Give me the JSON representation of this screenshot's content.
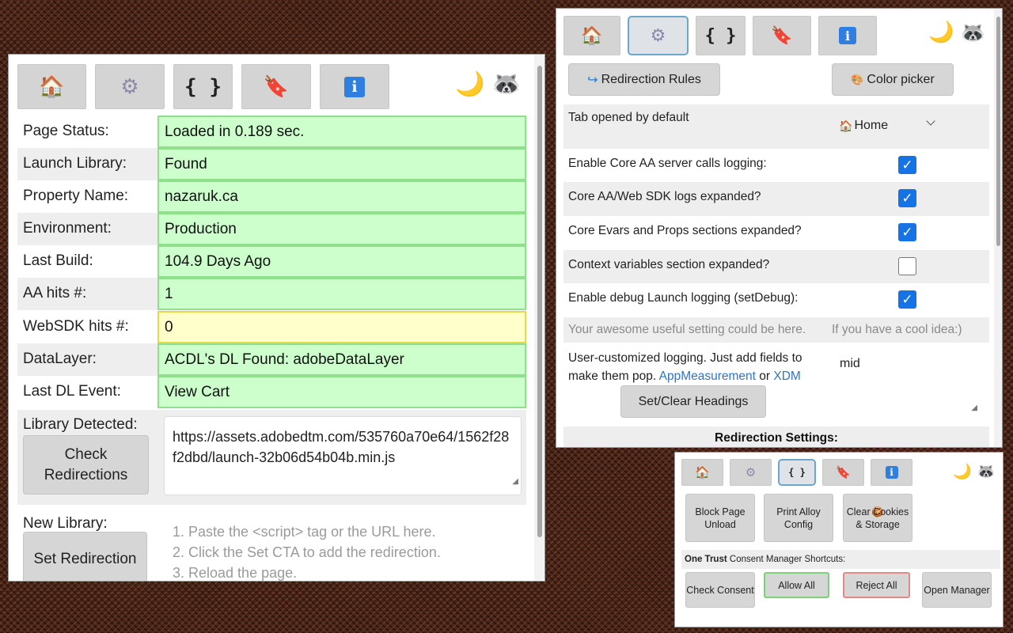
{
  "colors": {
    "ok_bg": "#ccffcc",
    "ok_border": "#8ee08a",
    "warn_bg": "#ffffcc",
    "warn_border": "#e6d84a",
    "checkbox": "#1673e6",
    "link": "#2f74c8"
  },
  "icons": {
    "home": "🏠",
    "settings": "⚙",
    "code": "{ }",
    "tag": "🔖",
    "info": "i",
    "moon": "🌙",
    "raccoon": "🦝"
  },
  "main": {
    "tabs": [
      {
        "name": "home-tab",
        "icon": "house-icon",
        "active": false
      },
      {
        "name": "settings-tab",
        "icon": "gear-icon",
        "active": false
      },
      {
        "name": "code-tab",
        "icon": "braces-icon",
        "active": false
      },
      {
        "name": "tag-tab",
        "icon": "tag-icon",
        "active": false
      },
      {
        "name": "info-tab",
        "icon": "info-icon",
        "active": false
      }
    ],
    "status": [
      {
        "label": "Page Status:",
        "value": "Loaded in 0.189 sec.",
        "state": "ok"
      },
      {
        "label": "Launch Library:",
        "value": "Found",
        "state": "ok"
      },
      {
        "label": "Property Name:",
        "value": "nazaruk.ca",
        "state": "ok"
      },
      {
        "label": "Environment:",
        "value": "Production",
        "state": "ok"
      },
      {
        "label": "Last Build:",
        "value": "104.9 Days Ago",
        "state": "ok"
      },
      {
        "label": "AA hits #:",
        "value": "1",
        "state": "ok"
      },
      {
        "label": "WebSDK hits #:",
        "value": "0",
        "state": "warn"
      },
      {
        "label": "DataLayer:",
        "value": "ACDL's DL Found: adobeDataLayer",
        "state": "ok"
      },
      {
        "label": "Last DL Event:",
        "value": "View Cart",
        "state": "ok"
      }
    ],
    "library_detected_label": "Library Detected:",
    "check_redirections_label": "Check Redirections",
    "library_url": "https://assets.adobedtm.com/535760a70e64/1562f28f2dbd/launch-32b06d54b04b.min.js",
    "new_library_label": "New Library:",
    "set_redirection_label": "Set Redirection",
    "new_library_placeholder": [
      "1. Paste the <script> tag or the URL here.",
      "2. Click the Set CTA to add the redirection.",
      "3. Reload the page."
    ]
  },
  "settings": {
    "redirection_rules_label": "Redirection Rules",
    "redirection_rules_icon": "↪",
    "color_picker_label": "Color picker",
    "color_picker_icon": "🎨",
    "default_tab_label": "Tab opened by default",
    "default_tab_value": "Home",
    "default_tab_icon": "🏠",
    "options": [
      {
        "label": "Enable Core AA server calls logging:",
        "checked": true
      },
      {
        "label": "Core AA/Web SDK logs expanded?",
        "checked": true
      },
      {
        "label": "Core Evars and Props sections expanded?",
        "checked": true
      },
      {
        "label": "Context variables section expanded?",
        "checked": false
      },
      {
        "label": "Enable debug Launch logging (setDebug):",
        "checked": true
      }
    ],
    "placeholder_setting_left": "Your awesome useful setting could be here.",
    "placeholder_setting_right": "If you have a cool idea:)",
    "custom_logging_text": "User-customized logging. Just add fields to make them pop.",
    "appmeasurement_link": "AppMeasurement",
    "or_text": "or",
    "xdm_link": "XDM",
    "custom_logging_value": "mid",
    "set_clear_headings_label": "Set/Clear Headings",
    "redirection_settings_heading": "Redirection Settings:"
  },
  "tools": {
    "block_unload_label": "Block Page Unload",
    "print_alloy_label": "Print Alloy Config",
    "clear_cookies_icon": "🍪",
    "clear_cookies_label": "Clear Cookies & Storage",
    "onetrust_bold": "One Trust",
    "onetrust_rest": "Consent Manager Shortcuts:",
    "check_consent_label": "Check Consent",
    "allow_all_label": "Allow All",
    "reject_all_label": "Reject All",
    "open_manager_label": "Open Manager"
  }
}
